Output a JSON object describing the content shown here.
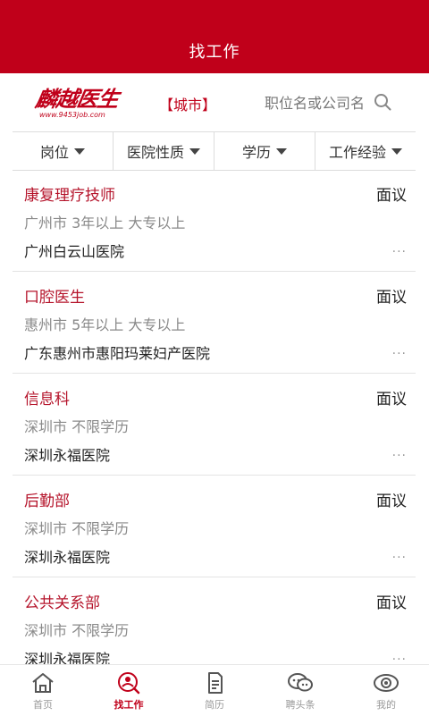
{
  "header": {
    "title": "找工作"
  },
  "brand": {
    "logo_text": "麟越医生",
    "logo_url_text": "www.9453job.com"
  },
  "city": {
    "label": "【城市】"
  },
  "search": {
    "placeholder": "职位名或公司名"
  },
  "filters": [
    {
      "label": "岗位"
    },
    {
      "label": "医院性质"
    },
    {
      "label": "学历"
    },
    {
      "label": "工作经验"
    }
  ],
  "jobs": [
    {
      "title": "康复理疗技师",
      "salary": "面议",
      "meta": "广州市 3年以上 大专以上",
      "company": "广州白云山医院",
      "more": "..."
    },
    {
      "title": "口腔医生",
      "salary": "面议",
      "meta": "惠州市 5年以上 大专以上",
      "company": "广东惠州市惠阳玛莱妇产医院",
      "more": "..."
    },
    {
      "title": "信息科",
      "salary": "面议",
      "meta": "深圳市 不限学历",
      "company": "深圳永福医院",
      "more": "..."
    },
    {
      "title": "后勤部",
      "salary": "面议",
      "meta": "深圳市 不限学历",
      "company": "深圳永福医院",
      "more": "..."
    },
    {
      "title": "公共关系部",
      "salary": "面议",
      "meta": "深圳市 不限学历",
      "company": "深圳永福医院",
      "more": "..."
    }
  ],
  "tabs": [
    {
      "label": "首页",
      "icon": "home-icon"
    },
    {
      "label": "找工作",
      "icon": "search-person-icon",
      "active": true
    },
    {
      "label": "简历",
      "icon": "document-icon"
    },
    {
      "label": "聘头条",
      "icon": "chat-icon"
    },
    {
      "label": "我的",
      "icon": "eye-icon"
    }
  ],
  "colors": {
    "brand": "#c0001a",
    "title": "#b5142b",
    "muted": "#8a8a8a"
  }
}
